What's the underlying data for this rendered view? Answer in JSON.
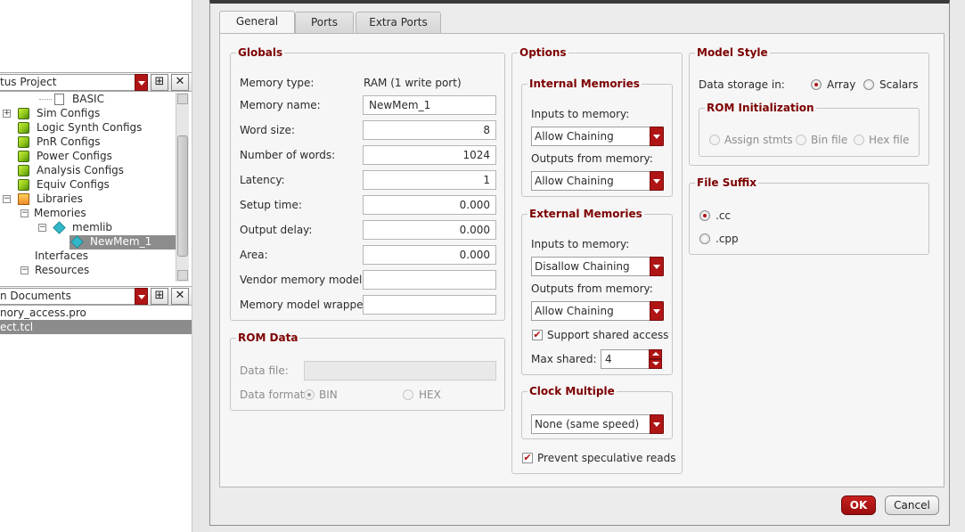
{
  "left_panel": {
    "project_combo": "tus Project",
    "tree": [
      {
        "label": "BASIC"
      },
      {
        "label": "Sim Configs"
      },
      {
        "label": "Logic Synth Configs"
      },
      {
        "label": "PnR Configs"
      },
      {
        "label": "Power Configs"
      },
      {
        "label": "Analysis Configs"
      },
      {
        "label": "Equiv Configs"
      },
      {
        "label": "Libraries"
      },
      {
        "label": "Memories"
      },
      {
        "label": "memlib"
      },
      {
        "label": "NewMem_1"
      },
      {
        "label": "Interfaces"
      },
      {
        "label": "Resources"
      }
    ],
    "documents_combo": "n Documents",
    "documents": [
      "nory_access.pro",
      "ect.tcl"
    ]
  },
  "dialog": {
    "tabs": [
      "General",
      "Ports",
      "Extra Ports"
    ],
    "active_tab": "General",
    "globals": {
      "title": "Globals",
      "memory_type_label": "Memory type:",
      "memory_type_value": "RAM (1 write port)",
      "memory_name_label": "Memory name:",
      "memory_name_value": "NewMem_1",
      "word_size_label": "Word size:",
      "word_size_value": "8",
      "num_words_label": "Number of words:",
      "num_words_value": "1024",
      "latency_label": "Latency:",
      "latency_value": "1",
      "setup_time_label": "Setup time:",
      "setup_time_value": "0.000",
      "output_delay_label": "Output delay:",
      "output_delay_value": "0.000",
      "area_label": "Area:",
      "area_value": "0.000",
      "vendor_model_label": "Vendor memory model:",
      "vendor_model_value": "",
      "wrapper_label": "Memory model wrapper:",
      "wrapper_value": ""
    },
    "rom_data": {
      "title": "ROM Data",
      "data_file_label": "Data file:",
      "data_file_value": "",
      "data_format_label": "Data format:",
      "bin_label": "BIN",
      "hex_label": "HEX",
      "selected": "BIN"
    },
    "options": {
      "title": "Options",
      "internal": {
        "title": "Internal Memories",
        "inputs_label": "Inputs to memory:",
        "inputs_value": "Allow Chaining",
        "outputs_label": "Outputs from memory:",
        "outputs_value": "Allow Chaining"
      },
      "external": {
        "title": "External Memories",
        "inputs_label": "Inputs to memory:",
        "inputs_value": "Disallow Chaining",
        "outputs_label": "Outputs from memory:",
        "outputs_value": "Allow Chaining",
        "shared_access_label": "Support shared access",
        "shared_access_checked": true,
        "max_shared_label": "Max shared:",
        "max_shared_value": "4"
      },
      "clock_multiple": {
        "title": "Clock Multiple",
        "value": "None (same speed)"
      },
      "prevent_speculative_label": "Prevent speculative reads",
      "prevent_speculative_checked": true
    },
    "model_style": {
      "title": "Model Style",
      "storage_label": "Data storage in:",
      "array_label": "Array",
      "scalars_label": "Scalars",
      "selected": "Array",
      "rom_init": {
        "title": "ROM Initialization",
        "assign_label": "Assign stmts",
        "bin_label": "Bin file",
        "hex_label": "Hex file"
      }
    },
    "file_suffix": {
      "title": "File Suffix",
      "cc_label": ".cc",
      "cpp_label": ".cpp",
      "selected": ".cc"
    },
    "buttons": {
      "ok": "OK",
      "cancel": "Cancel"
    }
  },
  "colors": {
    "accent": "#b01515",
    "group_title": "#7d0000",
    "selection": "#8c8c8c"
  }
}
